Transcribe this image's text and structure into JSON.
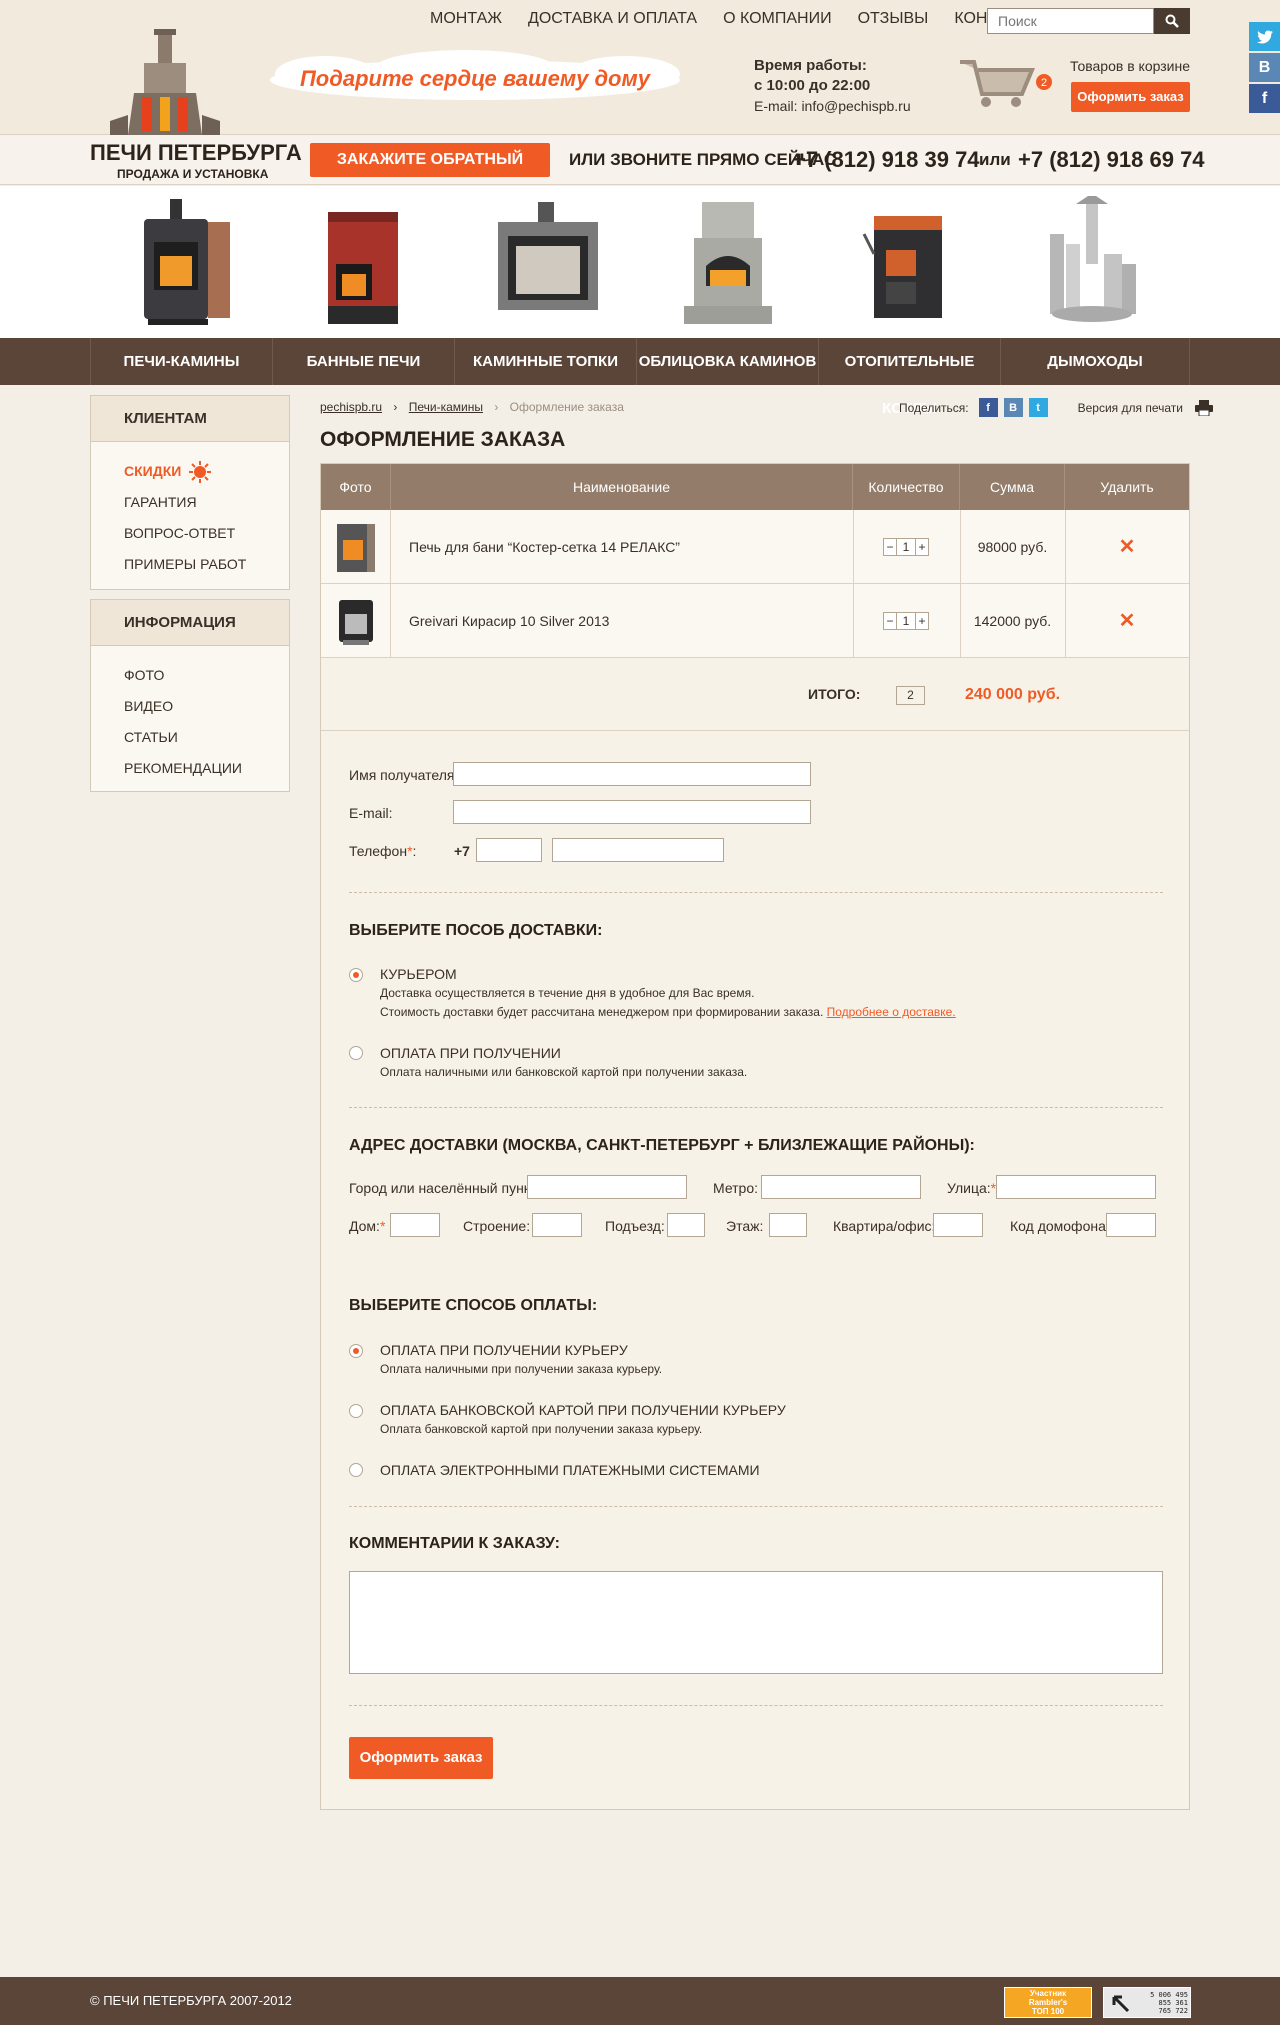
{
  "topnav": [
    "МОНТАЖ",
    "ДОСТАВКА И ОПЛАТА",
    "О КОМПАНИИ",
    "ОТЗЫВЫ",
    "КОНТАКТЫ"
  ],
  "search": {
    "placeholder": "Поиск"
  },
  "slogan": "Подарите сердце вашему дому",
  "hours": {
    "label": "Время работы:",
    "value": "с 10:00 до 22:00",
    "email": "E-mail: info@pechispb.ru"
  },
  "cart": {
    "count": "2",
    "label": "Товаров в корзине",
    "button": "Оформить заказ"
  },
  "social": [
    "twitter-icon",
    "vk-icon",
    "facebook-icon"
  ],
  "brand": {
    "name": "ПЕЧИ ПЕТЕРБУРГА",
    "sub": "ПРОДАЖА И УСТАНОВКА"
  },
  "callbar": {
    "button": "ЗАКАЖИТЕ ОБРАТНЫЙ ЗВОНОК",
    "or_text": "ИЛИ  ЗВОНИТЕ ПРЯМО СЕЙЧАС",
    "phone1": "+7 (812) 918 39 74",
    "or": "или",
    "phone2": "+7 (812) 918 69 74"
  },
  "categories": [
    "ПЕЧИ-КАМИНЫ",
    "БАННЫЕ ПЕЧИ",
    "КАМИННЫЕ ТОПКИ",
    "ОБЛИЦОВКА  КАМИНОВ",
    "ОТОПИТЕЛЬНЫЕ КОТЛЫ",
    "ДЫМОХОДЫ"
  ],
  "sidebar": {
    "clients": {
      "title": "КЛИЕНТАМ",
      "items": [
        "СКИДКИ",
        "ГАРАНТИЯ",
        "ВОПРОС-ОТВЕТ",
        "ПРИМЕРЫ РАБОТ"
      ]
    },
    "info": {
      "title": "ИНФОРМАЦИЯ",
      "items": [
        "ФОТО",
        "ВИДЕО",
        "СТАТЬИ",
        "РЕКОМЕНДАЦИИ"
      ]
    }
  },
  "breadcrumb": [
    "pechispb.ru",
    "Печи-камины",
    "Оформление заказа"
  ],
  "share": {
    "label": "Поделиться:",
    "print": "Версия для печати"
  },
  "page_title": "ОФОРМЛЕНИЕ ЗАКАЗА",
  "table": {
    "headers": [
      "Фото",
      "Наименование",
      "Количество",
      "Сумма",
      "Удалить"
    ],
    "rows": [
      {
        "name": "Печь для бани “Костер-сетка 14 РЕЛАКС”",
        "qty": "1",
        "sum": "98000 руб."
      },
      {
        "name": "Greivari Кирасир 10 Silver 2013",
        "qty": "1",
        "sum": "142000 руб."
      }
    ],
    "total_label": "ИТОГО:",
    "total_qty": "2",
    "total_sum": "240 000 руб."
  },
  "form": {
    "name_label": "Имя получателя:",
    "email_label": "E-mail:",
    "phone_label": "Телефон",
    "phone_prefix": "+7",
    "delivery_title": "ВЫБЕРИТЕ ПОСОБ ДОСТАВКИ:",
    "delivery_options": [
      {
        "title": "КУРЬЕРОМ",
        "desc1": "Доставка осуществляется в течение дня в удобное для Вас время.",
        "desc2": "Стоимость доставки будет рассчитана менеджером при формировании заказа.",
        "link": "Подробнее о доставке."
      },
      {
        "title": "ОПЛАТА ПРИ ПОЛУЧЕНИИ",
        "desc1": "Оплата наличными или банковской картой при получении заказа."
      }
    ],
    "address_title": "АДРЕС ДОСТАВКИ (МОСКВА, САНКТ-ПЕТЕРБУРГ + БЛИЗЛЕЖАЩИЕ РАЙОНЫ):",
    "address": {
      "city": "Город или населённый пункт:",
      "metro": "Метро:",
      "street": "Улица:",
      "house": "Дом:",
      "building": "Строение:",
      "entrance": "Подъезд:",
      "floor": "Этаж:",
      "flat": "Квартира/офис:",
      "code": "Код домофона:"
    },
    "payment_title": "ВЫБЕРИТЕ СПОСОБ ОПЛАТЫ:",
    "payment_options": [
      {
        "title": "ОПЛАТА ПРИ ПОЛУЧЕНИИ КУРЬЕРУ",
        "desc": "Оплата наличными при получении заказа курьеру."
      },
      {
        "title": "ОПЛАТА БАНКОВСКОЙ КАРТОЙ ПРИ ПОЛУЧЕНИИ КУРЬЕРУ",
        "desc": "Оплата банковской картой при получении заказа курьеру."
      },
      {
        "title": "ОПЛАТА ЭЛЕКТРОННЫМИ ПЛАТЕЖНЫМИ СИСТЕМАМИ"
      }
    ],
    "comment_title": "КОММЕНТАРИИ К ЗАКАЗУ:",
    "submit": "Оформить заказ"
  },
  "footer": {
    "copy": "©   ПЕЧИ ПЕТЕРБУРГА 2007-2012",
    "rambler": [
      "Участник",
      "Rambler's",
      "ТОП 100"
    ],
    "counter": [
      "5 006 495",
      "855 361",
      "765 722"
    ]
  },
  "colors": {
    "accent": "#f05a24",
    "brown": "#5a4538",
    "header_bg": "#f1eadd",
    "table_head": "#937c69"
  }
}
